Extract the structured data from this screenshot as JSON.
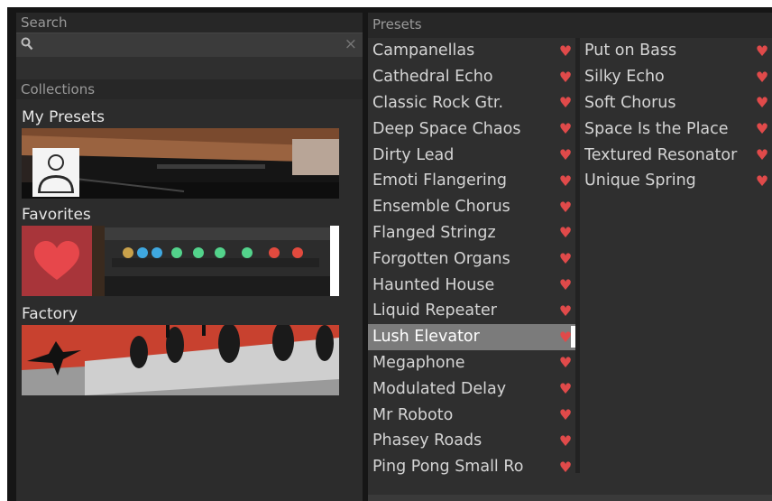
{
  "search": {
    "title": "Search",
    "placeholder": "",
    "clear_icon": "×"
  },
  "collections": {
    "title": "Collections",
    "items": [
      {
        "label": "My Presets",
        "icon": "user-icon"
      },
      {
        "label": "Favorites",
        "icon": "heart-icon"
      },
      {
        "label": "Factory",
        "icon": "bird-icon"
      }
    ]
  },
  "presets": {
    "title": "Presets",
    "heart_glyph": "♥",
    "heart_color": "#e04a4a",
    "col1": [
      "Campanellas",
      "Cathedral Echo",
      "Classic Rock Gtr.",
      "Deep Space Chaos",
      "Dirty Lead",
      "Emoti Flangering",
      "Ensemble Chorus",
      "Flanged Stringz",
      "Forgotten Organs",
      "Haunted House",
      "Liquid Repeater",
      "Lush Elevator",
      "Megaphone",
      "Modulated Delay",
      "Mr Roboto",
      "Phasey Roads",
      "Ping Pong Small Ro"
    ],
    "col2": [
      "Put on Bass",
      "Silky Echo",
      "Soft Chorus",
      "Space Is the Place",
      "Textured Resonator",
      "Unique Spring"
    ],
    "selected": "Lush Elevator"
  }
}
